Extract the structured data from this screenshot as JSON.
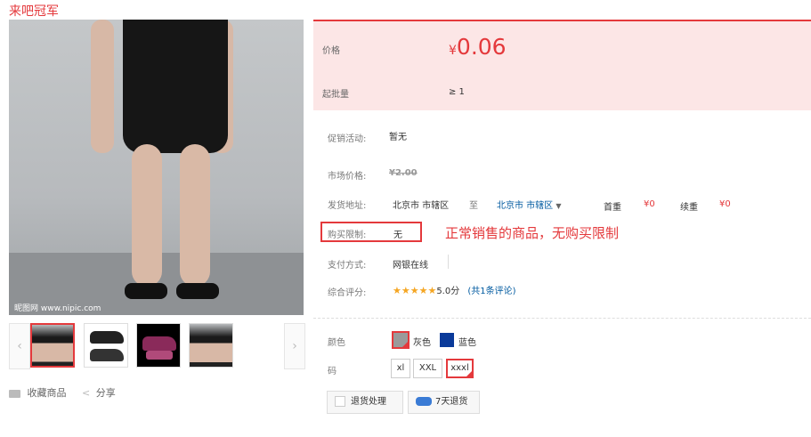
{
  "store": {
    "title": "来吧冠军"
  },
  "gallery": {
    "watermark": "昵图网 www.nipic.com",
    "prev_arrow": "‹",
    "next_arrow": "›"
  },
  "actions": {
    "favorite": "收藏商品",
    "share": "分享"
  },
  "price_box": {
    "price_label": "价格",
    "price_currency": "¥",
    "price_value": "0.06",
    "moq_label": "起批量",
    "moq_value": "≥ 1"
  },
  "details": {
    "promo_label": "促销活动:",
    "promo_value": "暂无",
    "market_label": "市场价格:",
    "market_value": "¥2.00",
    "ship_label": "发货地址:",
    "ship_from": "北京市 市辖区",
    "ship_to_word": "至",
    "ship_to": "北京市 市辖区",
    "first_label": "首重",
    "first_value": "¥0",
    "extra_label": "续重",
    "extra_value": "¥0",
    "limit_label": "购买限制:",
    "limit_value": "无",
    "limit_note": "正常销售的商品，无购买限制",
    "pay_label": "支付方式:",
    "pay_value": "网银在线",
    "rating_label": "综合评分:",
    "rating_stars": "★★★★★",
    "rating_score": "5.0分",
    "rating_link": "(共1条评论)"
  },
  "options": {
    "color_label": "颜色",
    "colors": [
      "灰色",
      "蓝色"
    ],
    "size_label": "码",
    "sizes": [
      "xl",
      "XXL",
      "xxxl"
    ]
  },
  "services": {
    "return_label": "退货处理",
    "seven_day_label": "7天退货"
  },
  "colors": {
    "accent": "#e4393c",
    "price_bg": "#fce6e6",
    "link": "#005aa0",
    "gray_swatch": "#9a9a9a",
    "blue_swatch": "#0a3a9a"
  }
}
